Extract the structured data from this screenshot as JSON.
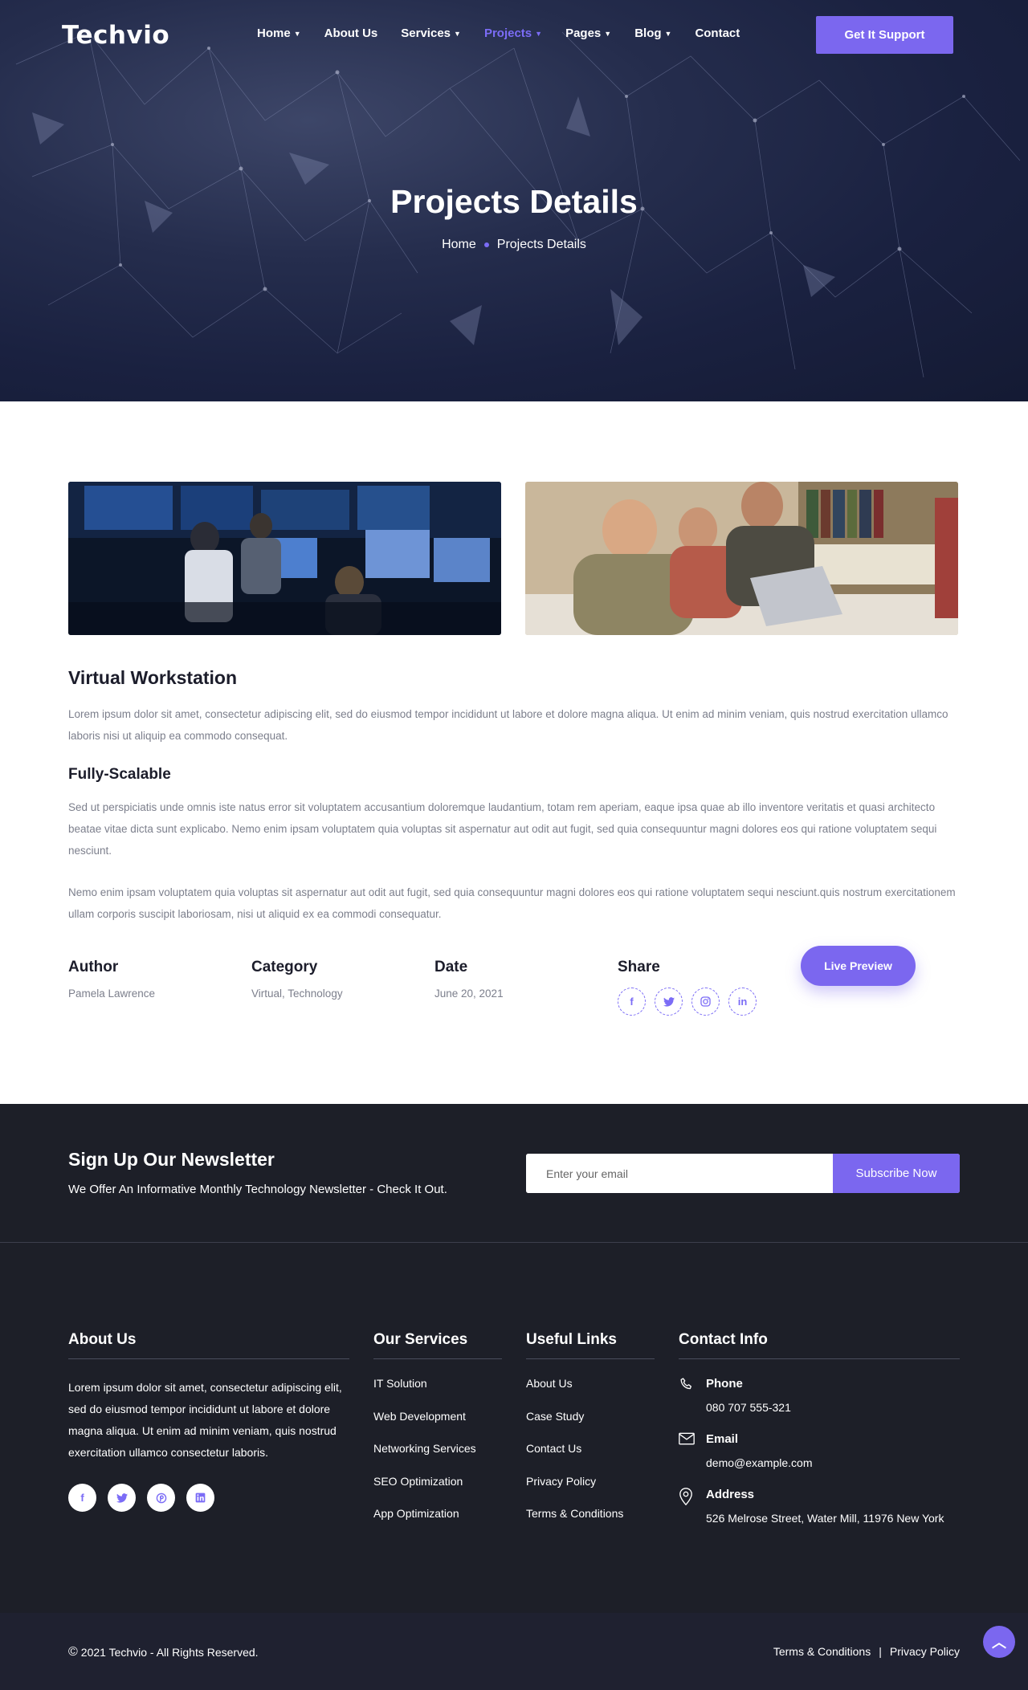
{
  "brand": {
    "logo": "Techvio",
    "accent": "#7b67ef",
    "dark": "#1d1f28"
  },
  "nav": {
    "items": [
      {
        "label": "Home",
        "dropdown": true
      },
      {
        "label": "About Us",
        "dropdown": false
      },
      {
        "label": "Services",
        "dropdown": true
      },
      {
        "label": "Projects",
        "dropdown": true,
        "active": true
      },
      {
        "label": "Pages",
        "dropdown": true
      },
      {
        "label": "Blog",
        "dropdown": true
      },
      {
        "label": "Contact",
        "dropdown": false
      }
    ],
    "cta": "Get It Support"
  },
  "hero": {
    "title": "Projects Details",
    "breadcrumb": {
      "home": "Home",
      "current": "Projects Details"
    }
  },
  "project": {
    "title": "Virtual Workstation",
    "intro": "Lorem ipsum dolor sit amet, consectetur adipiscing elit, sed do eiusmod tempor incididunt ut labore et dolore magna aliqua. Ut enim ad minim veniam, quis nostrud exercitation ullamco laboris nisi ut aliquip ea commodo consequat.",
    "subtitle": "Fully-Scalable",
    "para1": "Sed ut perspiciatis unde omnis iste natus error sit voluptatem accusantium doloremque laudantium, totam rem aperiam, eaque ipsa quae ab illo inventore veritatis et quasi architecto beatae vitae dicta sunt explicabo. Nemo enim ipsam voluptatem quia voluptas sit aspernatur aut odit aut fugit, sed quia consequuntur magni dolores eos qui ratione voluptatem sequi nesciunt.",
    "para2": "Nemo enim ipsam voluptatem quia voluptas sit aspernatur aut odit aut fugit, sed quia consequuntur magni dolores eos qui ratione voluptatem sequi nesciunt.quis nostrum exercitationem ullam corporis suscipit laboriosam, nisi ut aliquid ex ea commodi consequatur.",
    "meta": {
      "author_label": "Author",
      "author": "Pamela Lawrence",
      "category_label": "Category",
      "category": "Virtual, Technology",
      "date_label": "Date",
      "date": "June 20, 2021",
      "share_label": "Share"
    },
    "share_icons": [
      "facebook-icon",
      "twitter-icon",
      "instagram-icon",
      "linkedin-icon"
    ],
    "live_preview": "Live Preview"
  },
  "newsletter": {
    "title": "Sign Up Our Newsletter",
    "subtitle": "We Offer An Informative Monthly Technology Newsletter - Check It Out.",
    "placeholder": "Enter your email",
    "button": "Subscribe Now"
  },
  "footer": {
    "about": {
      "title": "About Us",
      "text": "Lorem ipsum dolor sit amet, consectetur adipiscing elit, sed do eiusmod tempor incididunt ut labore et dolore magna aliqua. Ut enim ad minim veniam, quis nostrud exercitation ullamco consectetur laboris."
    },
    "services": {
      "title": "Our Services",
      "links": [
        "IT Solution",
        "Web Development",
        "Networking Services",
        "SEO Optimization",
        "App Optimization"
      ]
    },
    "useful": {
      "title": "Useful Links",
      "links": [
        "About Us",
        "Case Study",
        "Contact Us",
        "Privacy Policy",
        "Terms & Conditions"
      ]
    },
    "contact": {
      "title": "Contact Info",
      "phone_label": "Phone",
      "phone": "080 707 555-321",
      "email_label": "Email",
      "email": "demo@example.com",
      "address_label": "Address",
      "address": "526 Melrose Street, Water Mill, 11976 New York"
    }
  },
  "bottom": {
    "copyright": "2021 Techvio - All Rights Reserved.",
    "terms": "Terms & Conditions",
    "separator": "|",
    "privacy": "Privacy Policy"
  }
}
